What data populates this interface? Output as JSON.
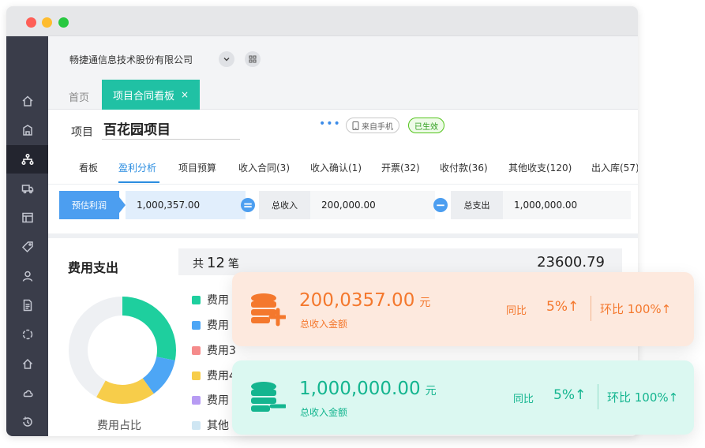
{
  "window": {
    "controls": [
      "close",
      "minimize",
      "maximize"
    ]
  },
  "sidebar": {
    "items": [
      {
        "icon": "home-icon"
      },
      {
        "icon": "building-icon"
      },
      {
        "icon": "network-icon",
        "active": true
      },
      {
        "icon": "truck-icon"
      },
      {
        "icon": "layout-icon"
      },
      {
        "icon": "tag-icon"
      },
      {
        "icon": "user-icon"
      },
      {
        "icon": "document-icon"
      },
      {
        "icon": "circle-icon"
      },
      {
        "icon": "house-icon"
      },
      {
        "icon": "cloud-icon"
      },
      {
        "icon": "history-icon"
      }
    ]
  },
  "topbar": {
    "company": "畅捷通信息技术股份有限公司"
  },
  "tabs": {
    "home": "首页",
    "active": "项目合同看板",
    "close": "×"
  },
  "header": {
    "project_label": "项目",
    "project_name": "百花园项目",
    "more": "•••",
    "source_badge": "来自手机",
    "status_badge": "已生效"
  },
  "subtabs": [
    "看板",
    "盈利分析",
    "项目预算",
    "收入合同(3)",
    "收入确认(1)",
    "开票(32)",
    "收付款(36)",
    "其他收支(120)",
    "出入库(57)"
  ],
  "active_subtab": "盈利分析",
  "summary": {
    "profit_label": "预估利润",
    "profit_value": "1,000,357.00",
    "equals": "=",
    "income_label": "总收入",
    "income_value": "200,000.00",
    "minus": "−",
    "expense_label": "总支出",
    "expense_value": "1,000,000.00"
  },
  "expense": {
    "title": "费用支出",
    "count_prefix": "共",
    "count": "12",
    "count_suffix": "笔",
    "total": "23600.79",
    "donut_caption": "费用占比",
    "legend": [
      {
        "label": "费用",
        "color": "#1ecf9e"
      },
      {
        "label": "费用",
        "color": "#4da6f5"
      },
      {
        "label": "费用3",
        "color": "#f58b8b"
      },
      {
        "label": "费用4",
        "color": "#f7cd4a"
      },
      {
        "label": "费用",
        "color": "#b79bf3"
      },
      {
        "label": "其他",
        "color": "#cfe6f3"
      }
    ]
  },
  "chart_data": {
    "type": "pie",
    "categories": [
      "费用",
      "费用",
      "费用3",
      "费用4",
      "费用",
      "其他"
    ],
    "values": [
      28,
      12,
      0,
      18,
      0,
      42
    ],
    "colors": [
      "#1ecf9e",
      "#4da6f5",
      "#f58b8b",
      "#f7cd4a",
      "#b79bf3",
      "#eef0f3"
    ],
    "title": "费用占比",
    "donut": true
  },
  "cards": [
    {
      "amount": "200,0357.00",
      "unit": "元",
      "label": "总收入金额",
      "yoy_label": "同比",
      "yoy_value": "5%↑",
      "mom": "环比 100%↑",
      "accent": "#f4782d",
      "icon": "coins-plus-icon"
    },
    {
      "amount": "1,000,000.00",
      "unit": "元",
      "label": "总收入金额",
      "yoy_label": "同比",
      "yoy_value": "5%↑",
      "mom": "环比 100%↑",
      "accent": "#14b58f",
      "icon": "coins-minus-icon"
    }
  ]
}
